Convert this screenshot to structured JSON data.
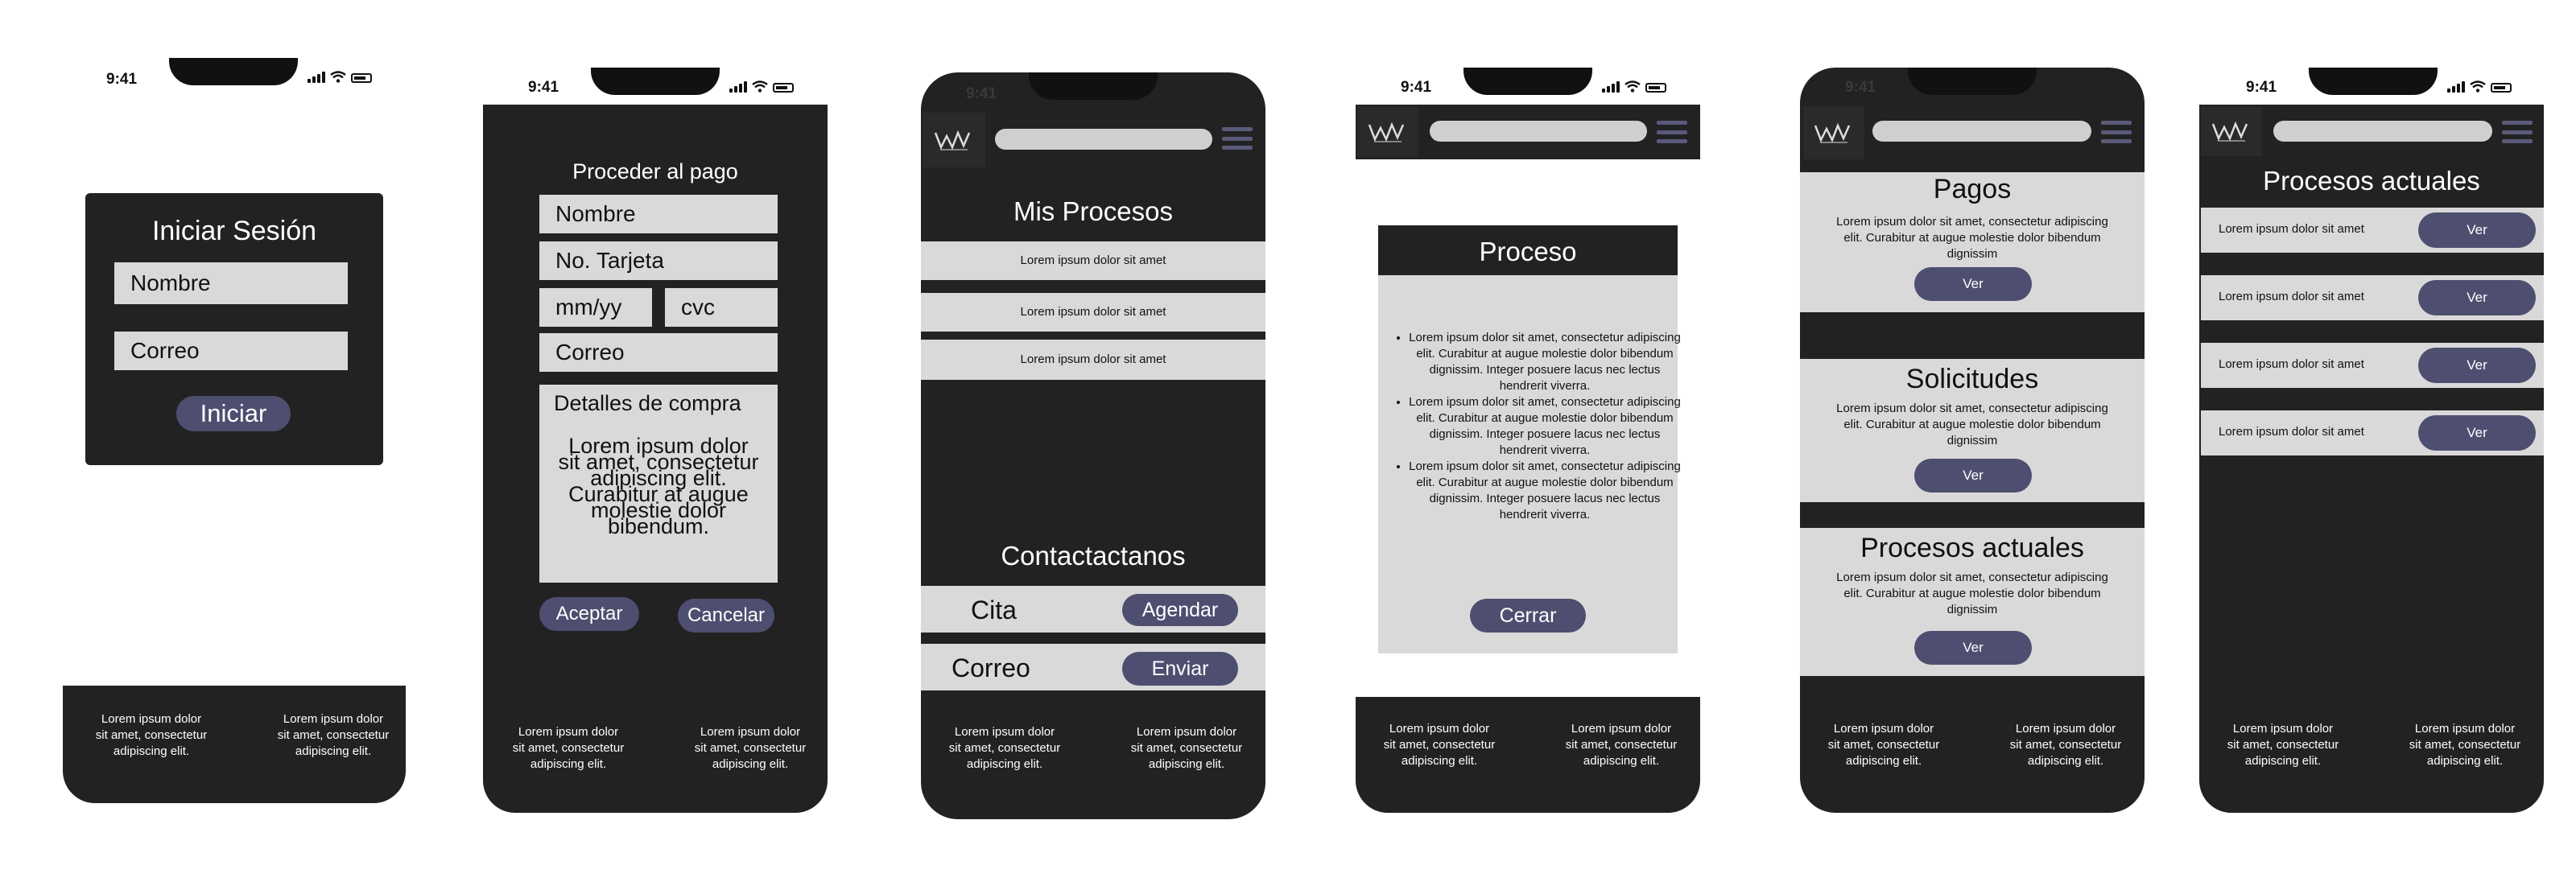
{
  "status": {
    "time": "9:41"
  },
  "footer": {
    "col1": "Lorem ipsum dolor sit amet, consectetur adipiscing elit.",
    "col2": "Lorem ipsum dolor sit amet, consectetur adipiscing elit."
  },
  "login": {
    "title": "Iniciar Sesión",
    "name_field": "Nombre",
    "email_field": "Correo",
    "submit": "Iniciar"
  },
  "payment": {
    "title": "Proceder al pago",
    "name_field": "Nombre",
    "card_field": "No. Tarjeta",
    "date_field": "mm/yy",
    "cvc_field": "cvc",
    "email_field": "Correo",
    "details_title": "Detalles de compra",
    "details_text": "Lorem ipsum dolor sit amet, consectetur adipiscing elit. Curabitur at augue molestie dolor bibendum.",
    "accept": "Aceptar",
    "cancel": "Cancelar"
  },
  "processes": {
    "title": "Mis Procesos",
    "items": [
      "Lorem ipsum dolor sit amet",
      "Lorem ipsum dolor sit amet",
      "Lorem ipsum dolor sit amet"
    ],
    "contact_title": "Contactactanos",
    "cita_label": "Cita",
    "cita_button": "Agendar",
    "correo_label": "Correo",
    "correo_button": "Enviar"
  },
  "proceso": {
    "title": "Proceso",
    "bullets": [
      "Lorem ipsum dolor sit amet, consectetur adipiscing elit. Curabitur at augue molestie dolor bibendum dignissim. Integer posuere lacus nec lectus hendrerit viverra.",
      "Lorem ipsum dolor sit amet, consectetur adipiscing elit. Curabitur at augue molestie dolor bibendum dignissim. Integer posuere lacus nec lectus hendrerit viverra.",
      "Lorem ipsum dolor sit amet, consectetur adipiscing elit. Curabitur at augue molestie dolor bibendum dignissim. Integer posuere lacus nec lectus hendrerit viverra."
    ],
    "close": "Cerrar"
  },
  "dashboard": {
    "sections": [
      {
        "title": "Pagos",
        "text": "Lorem ipsum dolor sit amet, consectetur adipiscing elit. Curabitur at augue molestie dolor bibendum dignissim",
        "button": "Ver"
      },
      {
        "title": "Solicitudes",
        "text": "Lorem ipsum dolor sit amet, consectetur adipiscing elit. Curabitur at augue molestie dolor bibendum dignissim",
        "button": "Ver"
      },
      {
        "title": "Procesos actuales",
        "text": "Lorem ipsum dolor sit amet, consectetur adipiscing elit. Curabitur at augue molestie dolor bibendum dignissim",
        "button": "Ver"
      }
    ]
  },
  "current": {
    "title": "Procesos actuales",
    "rows": [
      {
        "text": "Lorem ipsum dolor sit amet",
        "button": "Ver"
      },
      {
        "text": "Lorem ipsum dolor sit amet",
        "button": "Ver"
      },
      {
        "text": "Lorem ipsum dolor sit amet",
        "button": "Ver"
      },
      {
        "text": "Lorem ipsum dolor sit amet",
        "button": "Ver"
      }
    ]
  },
  "colors": {
    "dark": "#222222",
    "light": "#d9d9d9",
    "accent": "#4e4e70"
  },
  "icons": [
    "signal-icon",
    "wifi-icon",
    "battery-icon",
    "logo-icon",
    "menu-icon"
  ]
}
